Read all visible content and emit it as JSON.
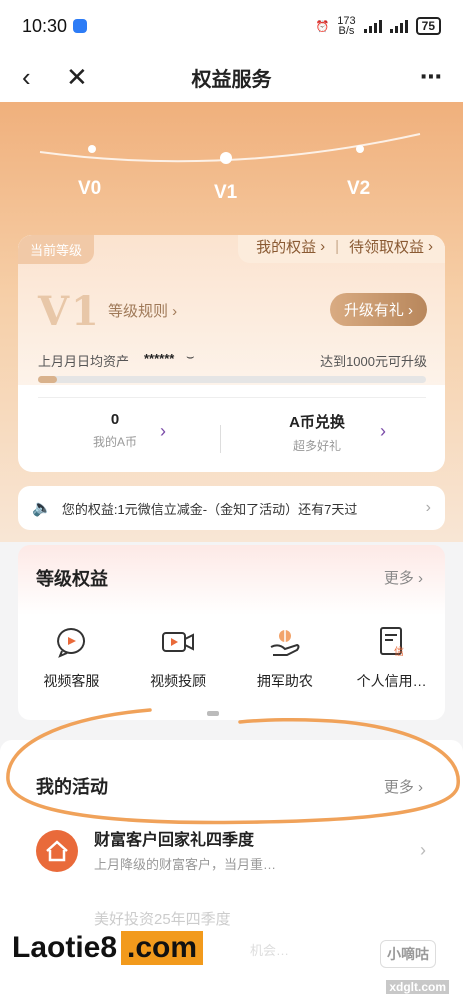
{
  "status": {
    "time": "10:30",
    "net_speed_top": "173",
    "net_speed_unit": "B/s",
    "battery": "75"
  },
  "nav": {
    "back_icon": "‹",
    "close_icon": "✕",
    "title": "权益服务",
    "more_icon": "⋯"
  },
  "levels": [
    "V0",
    "V1",
    "V2"
  ],
  "card": {
    "current_label": "当前等级",
    "my_rights": "我的权益",
    "pending_rights": "待领取权益",
    "level": "V1",
    "rule": "等级规则",
    "upgrade": "升级有礼",
    "asset_label": "上月月日均资产",
    "asset_masked": "******",
    "reach_text": "达到1000元可升级",
    "progress_percent": 5,
    "coins_value": "0",
    "coins_label": "我的A币",
    "exchange_value": "A币兑换",
    "exchange_label": "超多好礼"
  },
  "notice": {
    "text": "您的权益:1元微信立减金-（金知了活动）还有7天过"
  },
  "rights": {
    "title": "等级权益",
    "more": "更多",
    "items": [
      {
        "label": "视频客服",
        "icon": "video-chat-icon"
      },
      {
        "label": "视频投顾",
        "icon": "video-camera-icon"
      },
      {
        "label": "拥军助农",
        "icon": "hand-plant-icon"
      },
      {
        "label": "个人信用…",
        "icon": "credit-document-icon"
      }
    ]
  },
  "activities": {
    "title": "我的活动",
    "more": "更多",
    "item1_title": "财富客户回家礼四季度",
    "item1_desc": "上月降级的财富客户，当月重…",
    "item2_title": "美好投资25年四季度",
    "item2_desc": "机会…"
  },
  "watermarks": {
    "brand1": "Laotie8",
    "brand2": ".com",
    "brand3": "小嘀咕",
    "site": "xdglt.com"
  },
  "colors": {
    "accent": "#d9ab82",
    "purple": "#7b58d9",
    "orange": "#e96a3a"
  }
}
